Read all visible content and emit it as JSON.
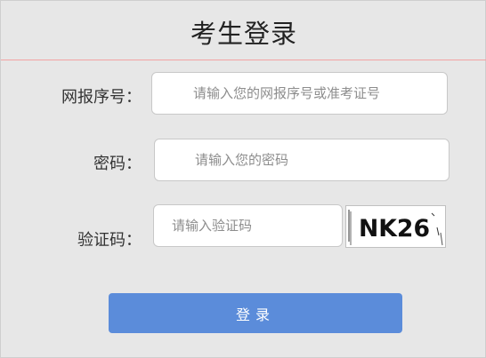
{
  "page": {
    "title": "考生登录"
  },
  "form": {
    "account_label": "网报序号：",
    "account_placeholder": "请输入您的网报序号或准考证号",
    "password_label": "密码：",
    "password_placeholder": "请输入您的密码",
    "captcha_label": "验证码：",
    "captcha_placeholder": "请输入验证码",
    "captcha_text": "NK26",
    "submit_label": "登录"
  },
  "colors": {
    "button": "#5b8cda",
    "title_divider": "#f2a3a3",
    "background": "#e7e7e7"
  }
}
